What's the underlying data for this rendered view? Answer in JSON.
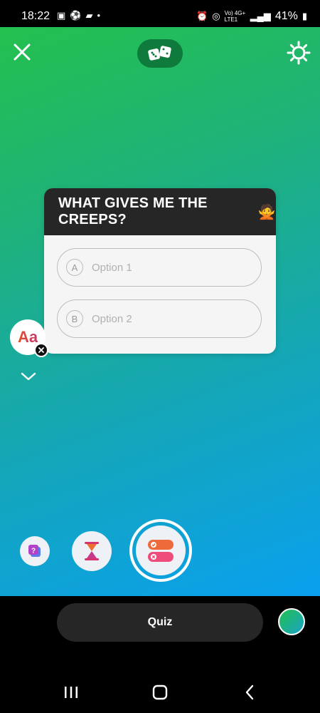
{
  "status_bar": {
    "time": "18:22",
    "network_label": "Vo) 4G+ LTE1",
    "battery": "41%"
  },
  "quiz": {
    "question": "WHAT GIVES ME THE CREEPS?",
    "emoji": "🙅",
    "options": [
      {
        "letter": "A",
        "placeholder": "Option 1"
      },
      {
        "letter": "B",
        "placeholder": "Option 2"
      }
    ]
  },
  "font_button": {
    "label": "Aa"
  },
  "bottom": {
    "mode_label": "Quiz"
  },
  "colors": {
    "gradient_top": "#24c04e",
    "gradient_bottom": "#0aa0ee",
    "card_header": "#262626",
    "pill_bg": "#262626"
  },
  "icons": {
    "close": "close-icon",
    "dice": "dice-icon",
    "settings": "gear-icon",
    "questions": "questions-sticker-icon",
    "timer": "hourglass-icon",
    "quiz": "quiz-sticker-icon"
  }
}
